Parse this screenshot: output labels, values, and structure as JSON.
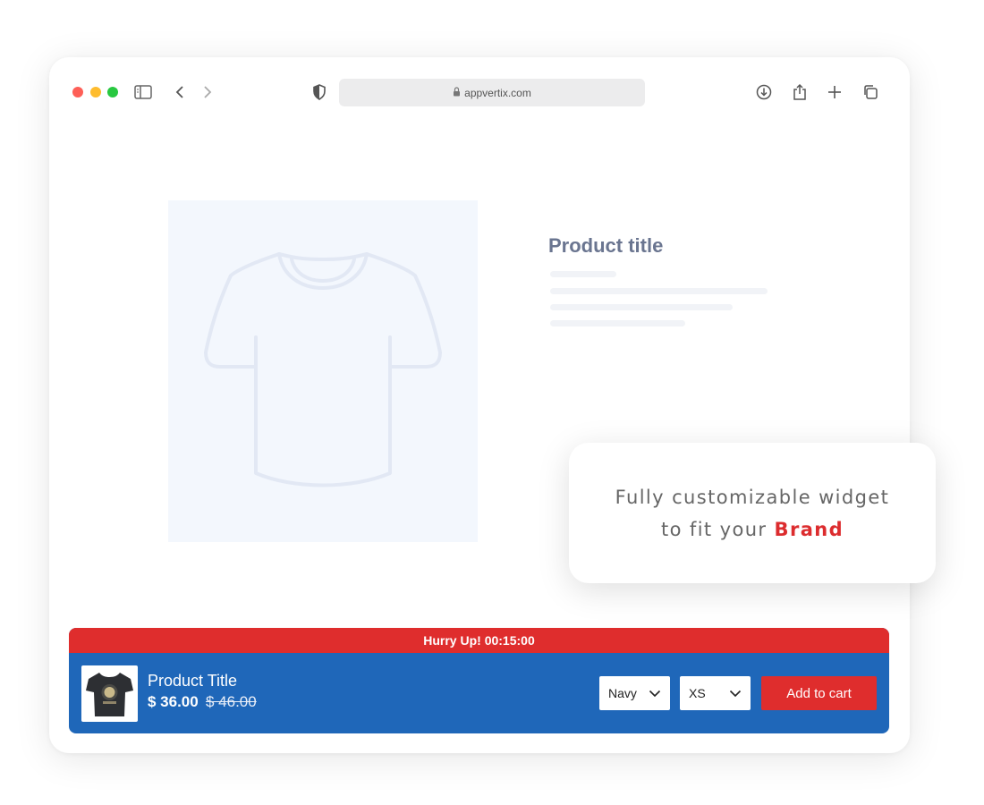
{
  "browser": {
    "url": "appvertix.com",
    "icons": {
      "sidebar": "sidebar-icon",
      "back": "chevron-left-icon",
      "forward": "chevron-right-icon",
      "shield": "shield-icon",
      "lock": "lock-icon",
      "download": "download-icon",
      "share": "share-icon",
      "new_tab": "plus-icon",
      "tabs": "tabs-icon"
    }
  },
  "page": {
    "product_title": "Product title",
    "image_icon": "tshirt-icon"
  },
  "callout": {
    "line1": "Fully customizable widget",
    "line2_prefix": "to fit your",
    "highlight": "Brand",
    "highlight_color": "#dc2c2e"
  },
  "widget": {
    "timer_text": "Hurry Up! 00:15:00",
    "product_title": "Product Title",
    "price": "$ 36.00",
    "compare_price": "$ 46.00",
    "color_option": "Navy",
    "size_option": "XS",
    "add_to_cart": "Add to cart",
    "colors": {
      "bar": "#1f67b9",
      "accent": "#df2d2d"
    }
  }
}
